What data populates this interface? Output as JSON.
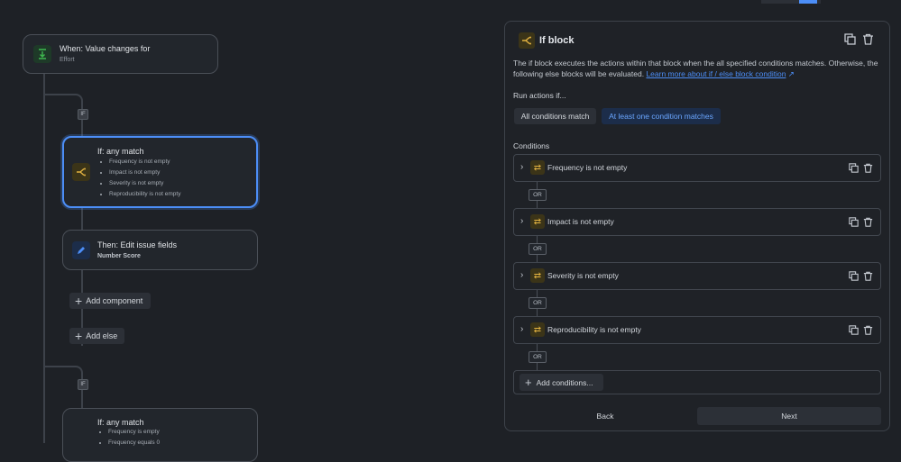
{
  "trigger": {
    "title": "When: Value changes for",
    "subtitle": "Effort"
  },
  "if_pill": "IF",
  "if_card": {
    "title": "If: any match",
    "items": [
      "Frequency is not empty",
      "Impact is not empty",
      "Severity is not empty",
      "Reproducibility is not empty"
    ]
  },
  "then_card": {
    "title": "Then: Edit issue fields",
    "subtitle": "Number Score"
  },
  "add_component": "Add component",
  "add_else": "Add else",
  "if_card2": {
    "title": "If: any match",
    "items": [
      "Frequency is empty",
      "Frequency equals 0"
    ]
  },
  "panel": {
    "title": "If block",
    "description": "The if block executes the actions within that block when the all specified conditions matches. Otherwise, the following else blocks will be evaluated.",
    "learn_more": "Learn more about if / else block condition",
    "run_label": "Run actions if...",
    "toggle_all": "All conditions match",
    "toggle_one": "At least one condition matches",
    "conditions_label": "Conditions",
    "conditions": [
      "Frequency is not empty",
      "Impact is not empty",
      "Severity is not empty",
      "Reproducibility is not empty"
    ],
    "or_label": "OR",
    "add_conditions": "Add conditions...",
    "back": "Back",
    "next": "Next"
  },
  "colors": {
    "accent": "#4c8ef7",
    "condition_icon": "#e3b341",
    "trigger_icon": "#3fb950"
  }
}
